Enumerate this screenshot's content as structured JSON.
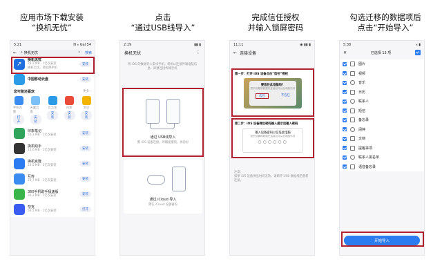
{
  "captions": [
    {
      "line1": "应用市场下载安装",
      "line2": "“换机无忧”"
    },
    {
      "line1": "点击",
      "line2": "“通过USB线导入”"
    },
    {
      "line1": "完成信任授权",
      "line2": "并输入锁屏密码"
    },
    {
      "line1": "勾选迁移的数据项后",
      "line2": "点击“开始导入”"
    }
  ],
  "p1": {
    "time": "5:21",
    "status": "N ⁎ Gal 54",
    "search": "换机无忧",
    "install": "安装",
    "top": [
      {
        "name": "换机无忧",
        "meta": "29.2 MB · 1亿次安装",
        "desc": "换机无忧，轻松换手机",
        "color": "#1f6fe0"
      },
      {
        "name": "中国移动云盘",
        "meta": "",
        "desc": "",
        "color": "#2b9be8"
      }
    ],
    "rec_title": "您可能还喜欢",
    "more": "更多 ›",
    "grid": [
      {
        "label": "手机克隆",
        "color": "#3a8cf0"
      },
      {
        "label": "天翼云盘",
        "color": "#7cc0f8"
      },
      {
        "label": "云之家",
        "color": "#2b9be8"
      },
      {
        "label": "同步",
        "color": "#e94d3a"
      },
      {
        "label": "宝贝",
        "color": "#f2b400"
      }
    ],
    "grid_btns": [
      "打开",
      "安装",
      "安装",
      "安装",
      "安装"
    ],
    "list": [
      {
        "name": "印象笔记",
        "meta": "50.3 MB · 1亿次安装",
        "color": "#2fa45a"
      },
      {
        "name": "换机助手",
        "meta": "15.6 MB · 1亿次安装",
        "color": "#222"
      },
      {
        "name": "换机克隆",
        "meta": "22.5 MB · 2亿次安装",
        "color": "#2b7cf0"
      },
      {
        "name": "互传",
        "meta": "29.7 MB · 1亿次安装",
        "color": "#3a8cf0"
      },
      {
        "name": "360手机助手极速版",
        "meta": "30.2 MB · 1亿次安装",
        "color": "#3ab54a"
      },
      {
        "name": "夸克",
        "meta": "56.5 MB · 1亿次安装",
        "color": "#3a5cf0"
      }
    ],
    "list_btns": [
      "安装",
      "安装",
      "安装",
      "安装",
      "安装",
      "打开"
    ]
  },
  "p2": {
    "time": "2:19",
    "status": "▮▮ ▮",
    "title": "换机无忧",
    "desc": "用 iOS 的数据导入安卓手机，将机以连接传输电脑信息，即建连接传输手机",
    "opt1": "通过 USB线导入",
    "opt1_sub": "需 iOS 设备连接，传输速度快，体验好",
    "opt2": "通过 iCloud 导入",
    "opt2_sub": "需在 iCloud 设备备份"
  },
  "p3": {
    "time": "11:11",
    "status": "◉ ▮▮ ▮",
    "title": "连接设备",
    "step1": "第一步：打开 iOS 设备点击“信任”授权",
    "trust_title": "要信任此电脑吗？",
    "trust_desc": "您的设置和数据在连接后可从此电脑访问",
    "trust_btn1": "信任",
    "trust_btn2": "不信任",
    "step2": "第二步：iOS 设备弹出密码输入提示后输入密码",
    "pw_title": "输入设备密码以信任此电脑",
    "pw_desc": "您的设置和数据在连接后可从此电脑访问",
    "note_title": "注意：",
    "note": "如果 iOS 设备弹出时间无效，请断开 USB 数据线后重新连接。"
  },
  "p4": {
    "time": "5:38",
    "status": "⁎ ▮",
    "title": "已选择 13 项",
    "items": [
      "图片",
      "视频",
      "音乐",
      "日历",
      "联系人",
      "短信",
      "备忘录",
      "闹钟",
      "文档",
      "提醒事项",
      "联系人黑名单",
      "语音备忘录"
    ],
    "start": "开始导入"
  }
}
